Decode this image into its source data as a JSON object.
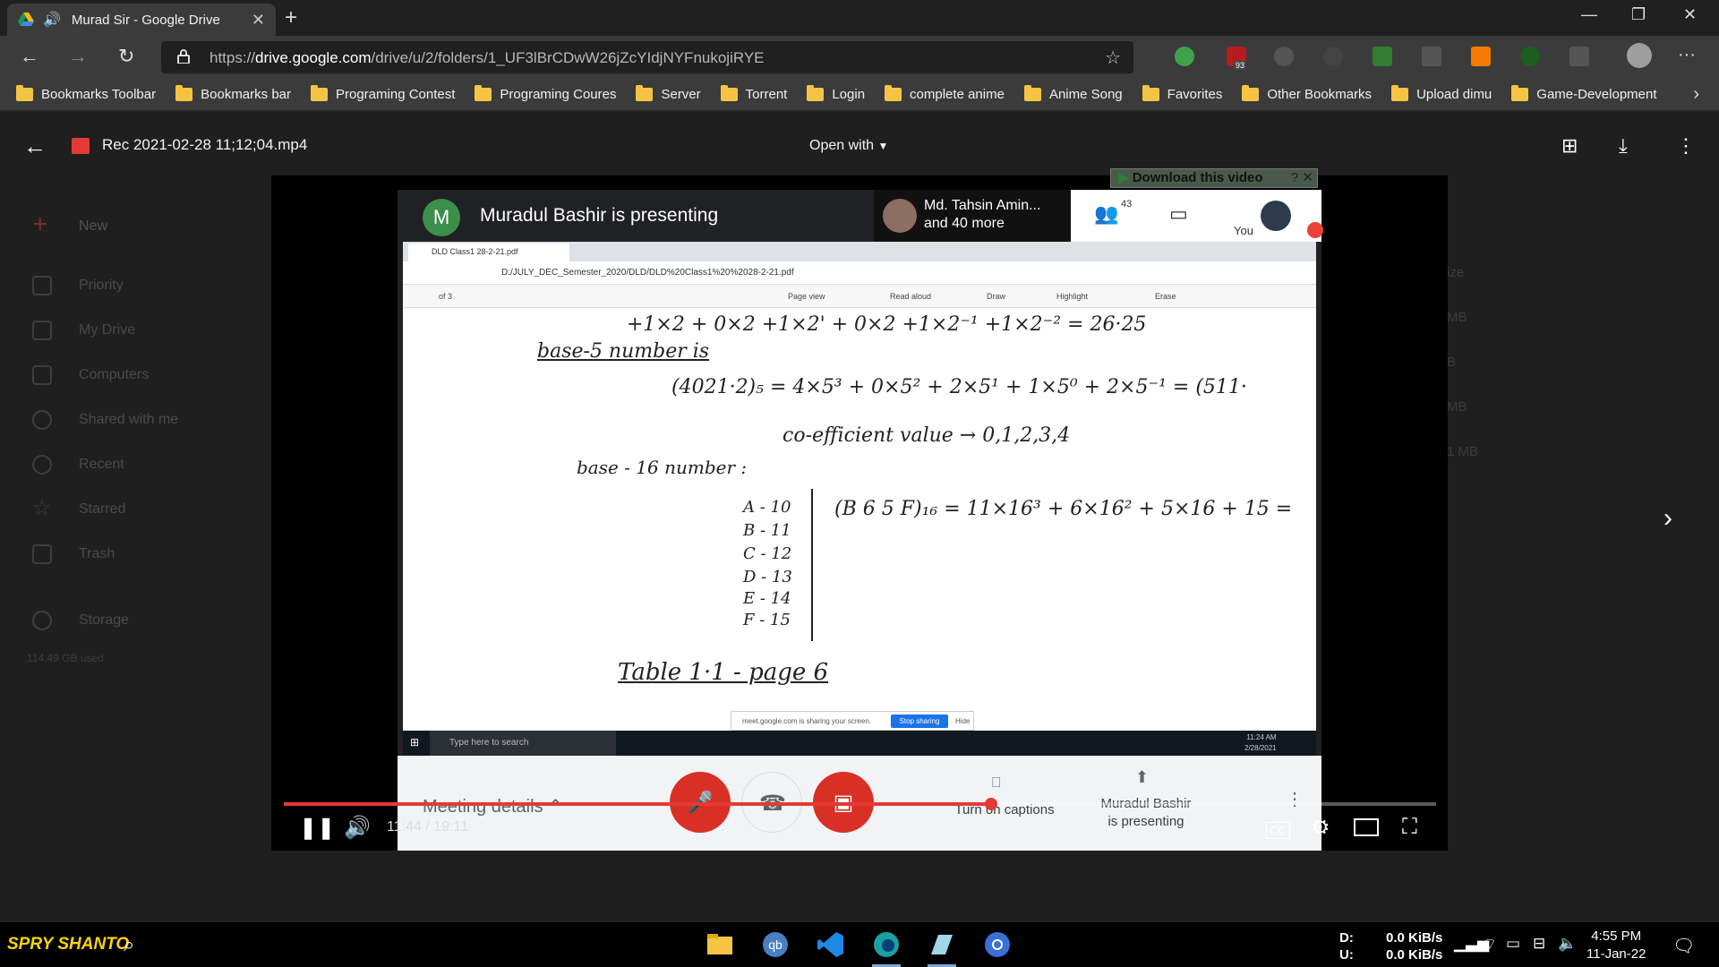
{
  "browser": {
    "tab_title": "Murad Sir - Google Drive",
    "url_prefix": "https://",
    "url_host": "drive.google.com",
    "url_path": "/drive/u/2/folders/1_UF3lBrCDwW26jZcYIdjNYFnukojiRYE"
  },
  "bookmarks": [
    "Bookmarks Toolbar",
    "Bookmarks bar",
    "Programing Contest",
    "Programing Coures",
    "Server",
    "Torrent",
    "Login",
    "complete anime",
    "Anime Song",
    "Favorites",
    "Other Bookmarks",
    "Upload dimu",
    "Game-Development"
  ],
  "extensions": {
    "badge_count": "93"
  },
  "drive_sidebar": [
    "New",
    "Priority",
    "My Drive",
    "Computers",
    "Shared with me",
    "Recent",
    "Starred",
    "Trash",
    "Storage"
  ],
  "drive_storage": "114.49 GB used",
  "drive_sizes": [
    "ize",
    "MB",
    "B",
    "MB",
    "1 MB"
  ],
  "viewer": {
    "file_name": "Rec 2021-02-28 11;12;04.mp4",
    "open_with": "Open with"
  },
  "download_badge": "Download this video",
  "meet": {
    "presenter_initial": "M",
    "presenting_text": "Muradul Bashir is presenting",
    "participant_line1": "Md. Tahsin Amin...",
    "participant_line2": "and 40 more",
    "people_count": "43",
    "you_label": "You",
    "meeting_details": "Meeting details",
    "captions_label": "Turn on captions",
    "presenting_label_1": "Muradul Bashir",
    "presenting_label_2": "is presenting"
  },
  "shared_screen": {
    "pdf_tab": "DLD Class1 28-2-21.pdf",
    "pdf_path": "D:/JULY_DEC_Semester_2020/DLD/DLD%20Class1%20%2028-2-21.pdf",
    "page_of": "of 3",
    "tool_page_view": "Page view",
    "tool_read_aloud": "Read aloud",
    "tool_draw": "Draw",
    "tool_highlight": "Highlight",
    "tool_erase": "Erase",
    "share_notice": "meet.google.com is sharing your screen.",
    "stop_sharing": "Stop sharing",
    "hide": "Hide",
    "win_search": "Type here to search",
    "win_time": "11:24 AM",
    "win_date": "2/28/2021",
    "ink_lines": [
      "+1×2 + 0×2 +1×2' + 0×2 +1×2⁻¹ +1×2⁻² = 26·25",
      "base-5 number is",
      "(4021·2)₅ = 4×5³ + 0×5² + 2×5¹ + 1×5⁰ + 2×5⁻¹ = (511·",
      "co-efficient value → 0,1,2,3,4",
      "base - 16 number :",
      "A - 10",
      "B - 11",
      "C - 12",
      "D - 13",
      "E - 14",
      "F - 15",
      "(B 6 5 F)₁₆ = 11×16³ + 6×16² + 5×16 + 15 =",
      "Table 1·1 - page 6"
    ]
  },
  "video": {
    "progress_fraction": 0.614,
    "time": "11:44 / 19:11",
    "cc_label": "CC"
  },
  "taskbar": {
    "brand": "SPRY SHANTO",
    "net_d_label": "D:",
    "net_u_label": "U:",
    "net_d_value": "0.0 KiB/s",
    "net_u_value": "0.0 KiB/s",
    "time": "4:55 PM",
    "date": "11-Jan-22"
  },
  "colors": {
    "accent_red": "#e53935",
    "meet_green": "#3c8f4a",
    "folder_yellow": "#f5c445",
    "brand_yellow": "#ffd400"
  }
}
